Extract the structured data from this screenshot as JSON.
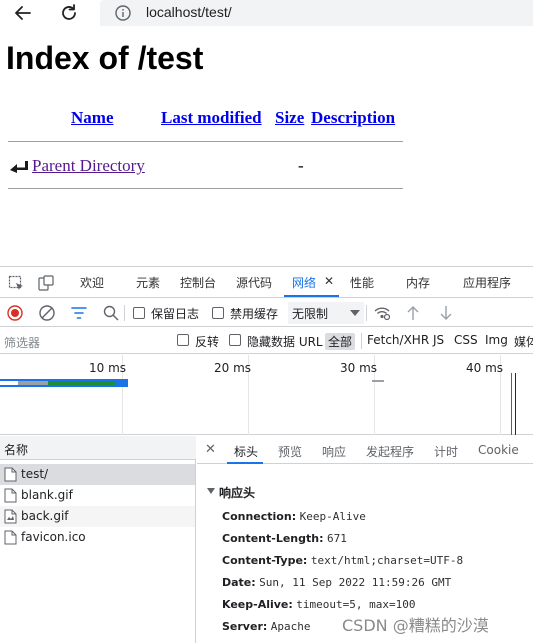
{
  "browser": {
    "url": "localhost/test/"
  },
  "page": {
    "title": "Index of /test",
    "columns": [
      "Name",
      "Last modified",
      "Size",
      "Description"
    ],
    "parent": {
      "name": "Parent Directory",
      "size": "-"
    }
  },
  "devtools": {
    "tabs": [
      "欢迎",
      "元素",
      "控制台",
      "源代码",
      "网络",
      "性能",
      "内存",
      "应用程序"
    ],
    "active_tab": "网络",
    "controls": {
      "preserve_log": "保留日志",
      "disable_cache": "禁用缓存",
      "throttle": "无限制"
    },
    "filter": {
      "placeholder": "筛选器",
      "invert": "反转",
      "hide_data_urls": "隐藏数据 URL",
      "types": [
        "全部",
        "Fetch/XHR",
        "JS",
        "CSS",
        "Img",
        "媒体"
      ],
      "selected_type": "全部"
    },
    "timeline": {
      "ticks": [
        "10 ms",
        "20 ms",
        "30 ms",
        "40 ms"
      ]
    },
    "requests": {
      "header": "名称",
      "items": [
        "test/",
        "blank.gif",
        "back.gif",
        "favicon.ico"
      ],
      "selected": "test/"
    },
    "detail": {
      "tabs": [
        "标头",
        "预览",
        "响应",
        "发起程序",
        "计时",
        "Cookie"
      ],
      "active_tab": "标头",
      "section": "响应头",
      "headers": [
        {
          "key": "Connection:",
          "value": "Keep-Alive"
        },
        {
          "key": "Content-Length:",
          "value": "671"
        },
        {
          "key": "Content-Type:",
          "value": "text/html;charset=UTF-8"
        },
        {
          "key": "Date:",
          "value": "Sun, 11 Sep 2022 11:59:26 GMT"
        },
        {
          "key": "Keep-Alive:",
          "value": "timeout=5, max=100"
        },
        {
          "key": "Server:",
          "value": "Apache"
        }
      ]
    }
  },
  "watermark": "CSDN @糟糕的沙漠"
}
